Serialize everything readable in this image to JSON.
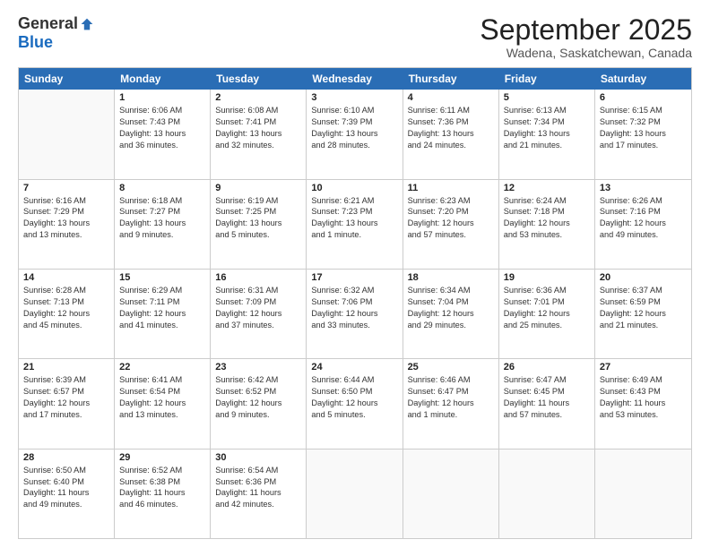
{
  "logo": {
    "general": "General",
    "blue": "Blue"
  },
  "title": "September 2025",
  "location": "Wadena, Saskatchewan, Canada",
  "days_of_week": [
    "Sunday",
    "Monday",
    "Tuesday",
    "Wednesday",
    "Thursday",
    "Friday",
    "Saturday"
  ],
  "weeks": [
    [
      {
        "day": "",
        "lines": []
      },
      {
        "day": "1",
        "lines": [
          "Sunrise: 6:06 AM",
          "Sunset: 7:43 PM",
          "Daylight: 13 hours",
          "and 36 minutes."
        ]
      },
      {
        "day": "2",
        "lines": [
          "Sunrise: 6:08 AM",
          "Sunset: 7:41 PM",
          "Daylight: 13 hours",
          "and 32 minutes."
        ]
      },
      {
        "day": "3",
        "lines": [
          "Sunrise: 6:10 AM",
          "Sunset: 7:39 PM",
          "Daylight: 13 hours",
          "and 28 minutes."
        ]
      },
      {
        "day": "4",
        "lines": [
          "Sunrise: 6:11 AM",
          "Sunset: 7:36 PM",
          "Daylight: 13 hours",
          "and 24 minutes."
        ]
      },
      {
        "day": "5",
        "lines": [
          "Sunrise: 6:13 AM",
          "Sunset: 7:34 PM",
          "Daylight: 13 hours",
          "and 21 minutes."
        ]
      },
      {
        "day": "6",
        "lines": [
          "Sunrise: 6:15 AM",
          "Sunset: 7:32 PM",
          "Daylight: 13 hours",
          "and 17 minutes."
        ]
      }
    ],
    [
      {
        "day": "7",
        "lines": [
          "Sunrise: 6:16 AM",
          "Sunset: 7:29 PM",
          "Daylight: 13 hours",
          "and 13 minutes."
        ]
      },
      {
        "day": "8",
        "lines": [
          "Sunrise: 6:18 AM",
          "Sunset: 7:27 PM",
          "Daylight: 13 hours",
          "and 9 minutes."
        ]
      },
      {
        "day": "9",
        "lines": [
          "Sunrise: 6:19 AM",
          "Sunset: 7:25 PM",
          "Daylight: 13 hours",
          "and 5 minutes."
        ]
      },
      {
        "day": "10",
        "lines": [
          "Sunrise: 6:21 AM",
          "Sunset: 7:23 PM",
          "Daylight: 13 hours",
          "and 1 minute."
        ]
      },
      {
        "day": "11",
        "lines": [
          "Sunrise: 6:23 AM",
          "Sunset: 7:20 PM",
          "Daylight: 12 hours",
          "and 57 minutes."
        ]
      },
      {
        "day": "12",
        "lines": [
          "Sunrise: 6:24 AM",
          "Sunset: 7:18 PM",
          "Daylight: 12 hours",
          "and 53 minutes."
        ]
      },
      {
        "day": "13",
        "lines": [
          "Sunrise: 6:26 AM",
          "Sunset: 7:16 PM",
          "Daylight: 12 hours",
          "and 49 minutes."
        ]
      }
    ],
    [
      {
        "day": "14",
        "lines": [
          "Sunrise: 6:28 AM",
          "Sunset: 7:13 PM",
          "Daylight: 12 hours",
          "and 45 minutes."
        ]
      },
      {
        "day": "15",
        "lines": [
          "Sunrise: 6:29 AM",
          "Sunset: 7:11 PM",
          "Daylight: 12 hours",
          "and 41 minutes."
        ]
      },
      {
        "day": "16",
        "lines": [
          "Sunrise: 6:31 AM",
          "Sunset: 7:09 PM",
          "Daylight: 12 hours",
          "and 37 minutes."
        ]
      },
      {
        "day": "17",
        "lines": [
          "Sunrise: 6:32 AM",
          "Sunset: 7:06 PM",
          "Daylight: 12 hours",
          "and 33 minutes."
        ]
      },
      {
        "day": "18",
        "lines": [
          "Sunrise: 6:34 AM",
          "Sunset: 7:04 PM",
          "Daylight: 12 hours",
          "and 29 minutes."
        ]
      },
      {
        "day": "19",
        "lines": [
          "Sunrise: 6:36 AM",
          "Sunset: 7:01 PM",
          "Daylight: 12 hours",
          "and 25 minutes."
        ]
      },
      {
        "day": "20",
        "lines": [
          "Sunrise: 6:37 AM",
          "Sunset: 6:59 PM",
          "Daylight: 12 hours",
          "and 21 minutes."
        ]
      }
    ],
    [
      {
        "day": "21",
        "lines": [
          "Sunrise: 6:39 AM",
          "Sunset: 6:57 PM",
          "Daylight: 12 hours",
          "and 17 minutes."
        ]
      },
      {
        "day": "22",
        "lines": [
          "Sunrise: 6:41 AM",
          "Sunset: 6:54 PM",
          "Daylight: 12 hours",
          "and 13 minutes."
        ]
      },
      {
        "day": "23",
        "lines": [
          "Sunrise: 6:42 AM",
          "Sunset: 6:52 PM",
          "Daylight: 12 hours",
          "and 9 minutes."
        ]
      },
      {
        "day": "24",
        "lines": [
          "Sunrise: 6:44 AM",
          "Sunset: 6:50 PM",
          "Daylight: 12 hours",
          "and 5 minutes."
        ]
      },
      {
        "day": "25",
        "lines": [
          "Sunrise: 6:46 AM",
          "Sunset: 6:47 PM",
          "Daylight: 12 hours",
          "and 1 minute."
        ]
      },
      {
        "day": "26",
        "lines": [
          "Sunrise: 6:47 AM",
          "Sunset: 6:45 PM",
          "Daylight: 11 hours",
          "and 57 minutes."
        ]
      },
      {
        "day": "27",
        "lines": [
          "Sunrise: 6:49 AM",
          "Sunset: 6:43 PM",
          "Daylight: 11 hours",
          "and 53 minutes."
        ]
      }
    ],
    [
      {
        "day": "28",
        "lines": [
          "Sunrise: 6:50 AM",
          "Sunset: 6:40 PM",
          "Daylight: 11 hours",
          "and 49 minutes."
        ]
      },
      {
        "day": "29",
        "lines": [
          "Sunrise: 6:52 AM",
          "Sunset: 6:38 PM",
          "Daylight: 11 hours",
          "and 46 minutes."
        ]
      },
      {
        "day": "30",
        "lines": [
          "Sunrise: 6:54 AM",
          "Sunset: 6:36 PM",
          "Daylight: 11 hours",
          "and 42 minutes."
        ]
      },
      {
        "day": "",
        "lines": []
      },
      {
        "day": "",
        "lines": []
      },
      {
        "day": "",
        "lines": []
      },
      {
        "day": "",
        "lines": []
      }
    ]
  ]
}
